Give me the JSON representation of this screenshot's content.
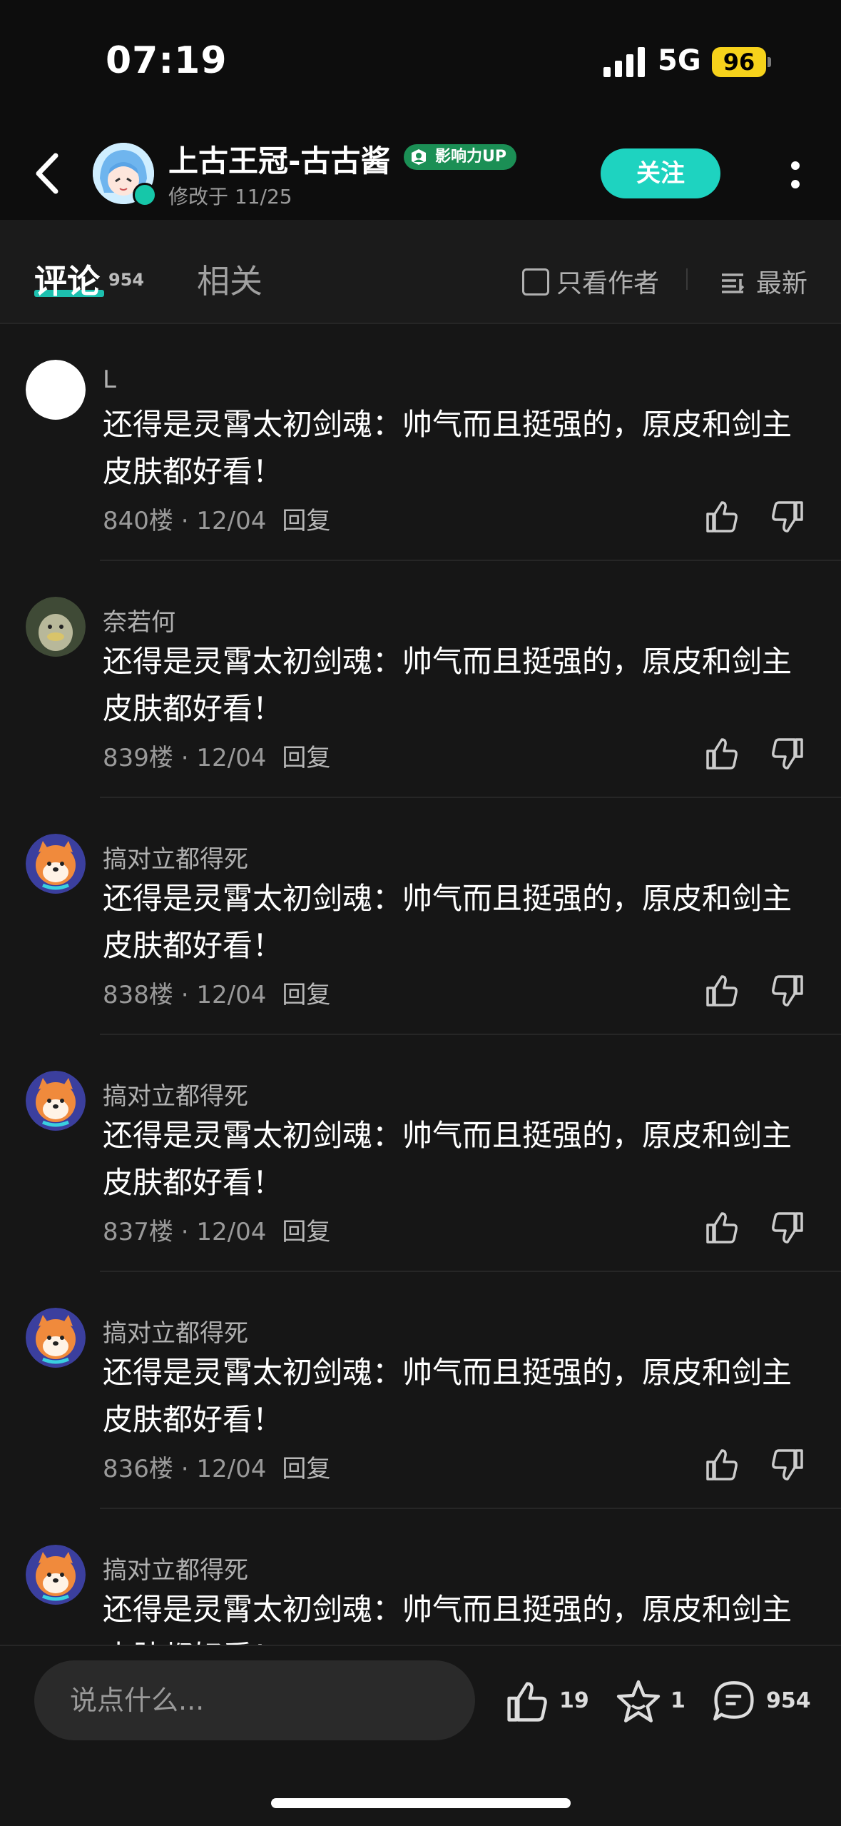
{
  "status_bar": {
    "time": "07:19",
    "network": "5G",
    "battery": "96"
  },
  "header": {
    "author_name": "上古王冠-古古酱",
    "badge": "影响力UP",
    "modified": "修改于 11/25",
    "follow_label": "关注"
  },
  "tabs": {
    "comments_label": "评论",
    "comments_count": "954",
    "related_label": "相关",
    "author_only_label": "只看作者",
    "sort_label": "最新"
  },
  "comments": [
    {
      "user": "L",
      "text": "还得是灵霄太初剑魂：帅气而且挺强的，原皮和剑主皮肤都好看！",
      "floor": "840楼",
      "date": "12/04",
      "reply": "回复",
      "avatar": "white-circle-avatar"
    },
    {
      "user": "奈若何",
      "text": "还得是灵霄太初剑魂：帅气而且挺强的，原皮和剑主皮肤都好看！",
      "floor": "839楼",
      "date": "12/04",
      "reply": "回复",
      "avatar": "duck-avatar"
    },
    {
      "user": "搞对立都得死",
      "text": "还得是灵霄太初剑魂：帅气而且挺强的，原皮和剑主皮肤都好看！",
      "floor": "838楼",
      "date": "12/04",
      "reply": "回复",
      "avatar": "shiba-dog-avatar"
    },
    {
      "user": "搞对立都得死",
      "text": "还得是灵霄太初剑魂：帅气而且挺强的，原皮和剑主皮肤都好看！",
      "floor": "837楼",
      "date": "12/04",
      "reply": "回复",
      "avatar": "shiba-dog-avatar"
    },
    {
      "user": "搞对立都得死",
      "text": "还得是灵霄太初剑魂：帅气而且挺强的，原皮和剑主皮肤都好看！",
      "floor": "836楼",
      "date": "12/04",
      "reply": "回复",
      "avatar": "shiba-dog-avatar"
    },
    {
      "user": "搞对立都得死",
      "text": "还得是灵霄太初剑魂：帅气而且挺强的，原皮和剑主皮肤都好看！",
      "floor": "",
      "date": "",
      "reply": "",
      "avatar": "shiba-dog-avatar"
    }
  ],
  "bottom_bar": {
    "input_placeholder": "说点什么...",
    "like_count": "19",
    "favorite_count": "1",
    "comment_count": "954"
  },
  "colors": {
    "accent": "#1ed3c0",
    "background": "#161616",
    "badge_green": "#1b8f55",
    "battery": "#f6d21b"
  }
}
